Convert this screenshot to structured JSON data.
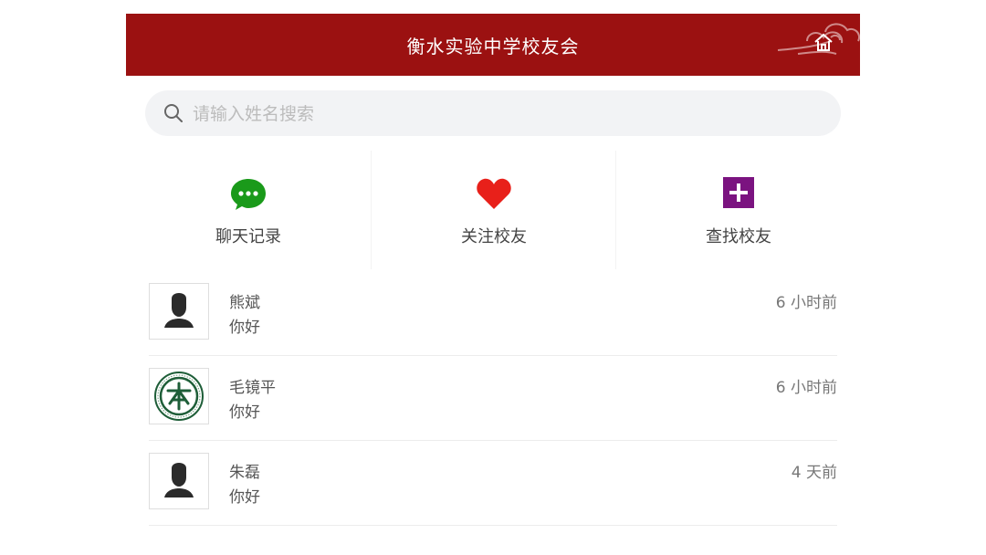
{
  "header": {
    "title": "衡水实验中学校友会",
    "bg_color": "#9b1111",
    "right_icon": "home-icon"
  },
  "search": {
    "placeholder": "请输入姓名搜索",
    "value": ""
  },
  "actions": [
    {
      "label": "聊天记录",
      "icon": "chat-bubble-icon",
      "color": "#1a9a1a"
    },
    {
      "label": "关注校友",
      "icon": "heart-icon",
      "color": "#e8201a"
    },
    {
      "label": "查找校友",
      "icon": "plus-square-icon",
      "color": "#7b1380"
    }
  ],
  "conversations": [
    {
      "name": "熊斌",
      "message": "你好",
      "time": "6 小时前",
      "avatar": "default-avatar-icon"
    },
    {
      "name": "毛镜平",
      "message": "你好",
      "time": "6 小时前",
      "avatar": "school-logo-icon"
    },
    {
      "name": "朱磊",
      "message": "你好",
      "time": "4 天前",
      "avatar": "default-avatar-icon"
    }
  ]
}
